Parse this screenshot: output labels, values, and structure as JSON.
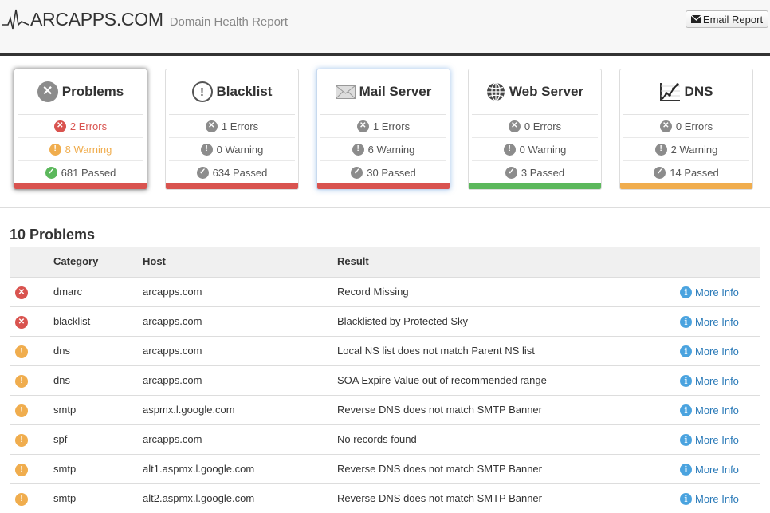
{
  "header": {
    "brand": "ARCAPPS.COM",
    "subtitle": "Domain Health Report",
    "email_button": "Email Report"
  },
  "cards": [
    {
      "title": "Problems",
      "icon": "x-circle-icon",
      "errors": "2 Errors",
      "warnings": "8 Warning",
      "passed": "681 Passed",
      "bar_color": "#d9534f"
    },
    {
      "title": "Blacklist",
      "icon": "exclamation-circle-icon",
      "errors": "1 Errors",
      "warnings": "0 Warning",
      "passed": "634 Passed",
      "bar_color": "#d9534f"
    },
    {
      "title": "Mail Server",
      "icon": "envelope-icon",
      "errors": "1 Errors",
      "warnings": "6 Warning",
      "passed": "30 Passed",
      "bar_color": "#d9534f"
    },
    {
      "title": "Web Server",
      "icon": "globe-icon",
      "errors": "0 Errors",
      "warnings": "0 Warning",
      "passed": "3 Passed",
      "bar_color": "#5cb85c"
    },
    {
      "title": "DNS",
      "icon": "line-chart-icon",
      "errors": "0 Errors",
      "warnings": "2 Warning",
      "passed": "14 Passed",
      "bar_color": "#f0ad4e"
    }
  ],
  "problems": {
    "title": "10 Problems",
    "columns": [
      "",
      "Category",
      "Host",
      "Result",
      ""
    ],
    "more_label": "More Info",
    "rows": [
      {
        "status": "error",
        "category": "dmarc",
        "host": "arcapps.com",
        "result": "Record Missing"
      },
      {
        "status": "error",
        "category": "blacklist",
        "host": "arcapps.com",
        "result": "Blacklisted by Protected Sky"
      },
      {
        "status": "warning",
        "category": "dns",
        "host": "arcapps.com",
        "result": "Local NS list does not match Parent NS list"
      },
      {
        "status": "warning",
        "category": "dns",
        "host": "arcapps.com",
        "result": "SOA Expire Value out of recommended range"
      },
      {
        "status": "warning",
        "category": "smtp",
        "host": "aspmx.l.google.com",
        "result": "Reverse DNS does not match SMTP Banner"
      },
      {
        "status": "warning",
        "category": "spf",
        "host": "arcapps.com",
        "result": "No records found"
      },
      {
        "status": "warning",
        "category": "smtp",
        "host": "alt1.aspmx.l.google.com",
        "result": "Reverse DNS does not match SMTP Banner"
      },
      {
        "status": "warning",
        "category": "smtp",
        "host": "alt2.aspmx.l.google.com",
        "result": "Reverse DNS does not match SMTP Banner"
      }
    ]
  }
}
